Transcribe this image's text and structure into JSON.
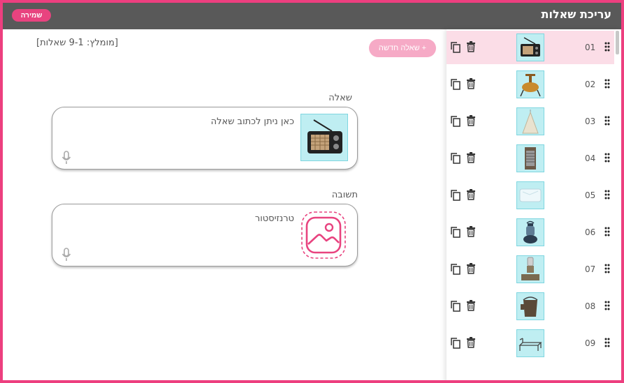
{
  "header": {
    "title": "עריכת שאלות",
    "save_label": "שמירה"
  },
  "toolbar": {
    "hint": "[מומלץ: 9-1 שאלות]",
    "new_question_label": "+ שאלה חדשה"
  },
  "editor": {
    "question_label": "שאלה",
    "question_text": "כאן ניתן לכתוב שאלה",
    "answer_label": "תשובה",
    "answer_text": "טרנזיסטור"
  },
  "questions": [
    {
      "num": "01",
      "thumb": "radio-icon"
    },
    {
      "num": "02",
      "thumb": "primus-stove-icon"
    },
    {
      "num": "03",
      "thumb": "mosquito-net-icon"
    },
    {
      "num": "04",
      "thumb": "washboard-icon"
    },
    {
      "num": "05",
      "thumb": "ice-block-icon"
    },
    {
      "num": "06",
      "thumb": "lantern-icon"
    },
    {
      "num": "07",
      "thumb": "kerosene-lamp-icon"
    },
    {
      "num": "08",
      "thumb": "bucket-icon"
    },
    {
      "num": "09",
      "thumb": "cot-bed-icon"
    }
  ],
  "colors": {
    "accent": "#e8437f",
    "header": "#595959",
    "selected_row": "#fbdde7",
    "thumb_bg": "#bfeef2"
  }
}
